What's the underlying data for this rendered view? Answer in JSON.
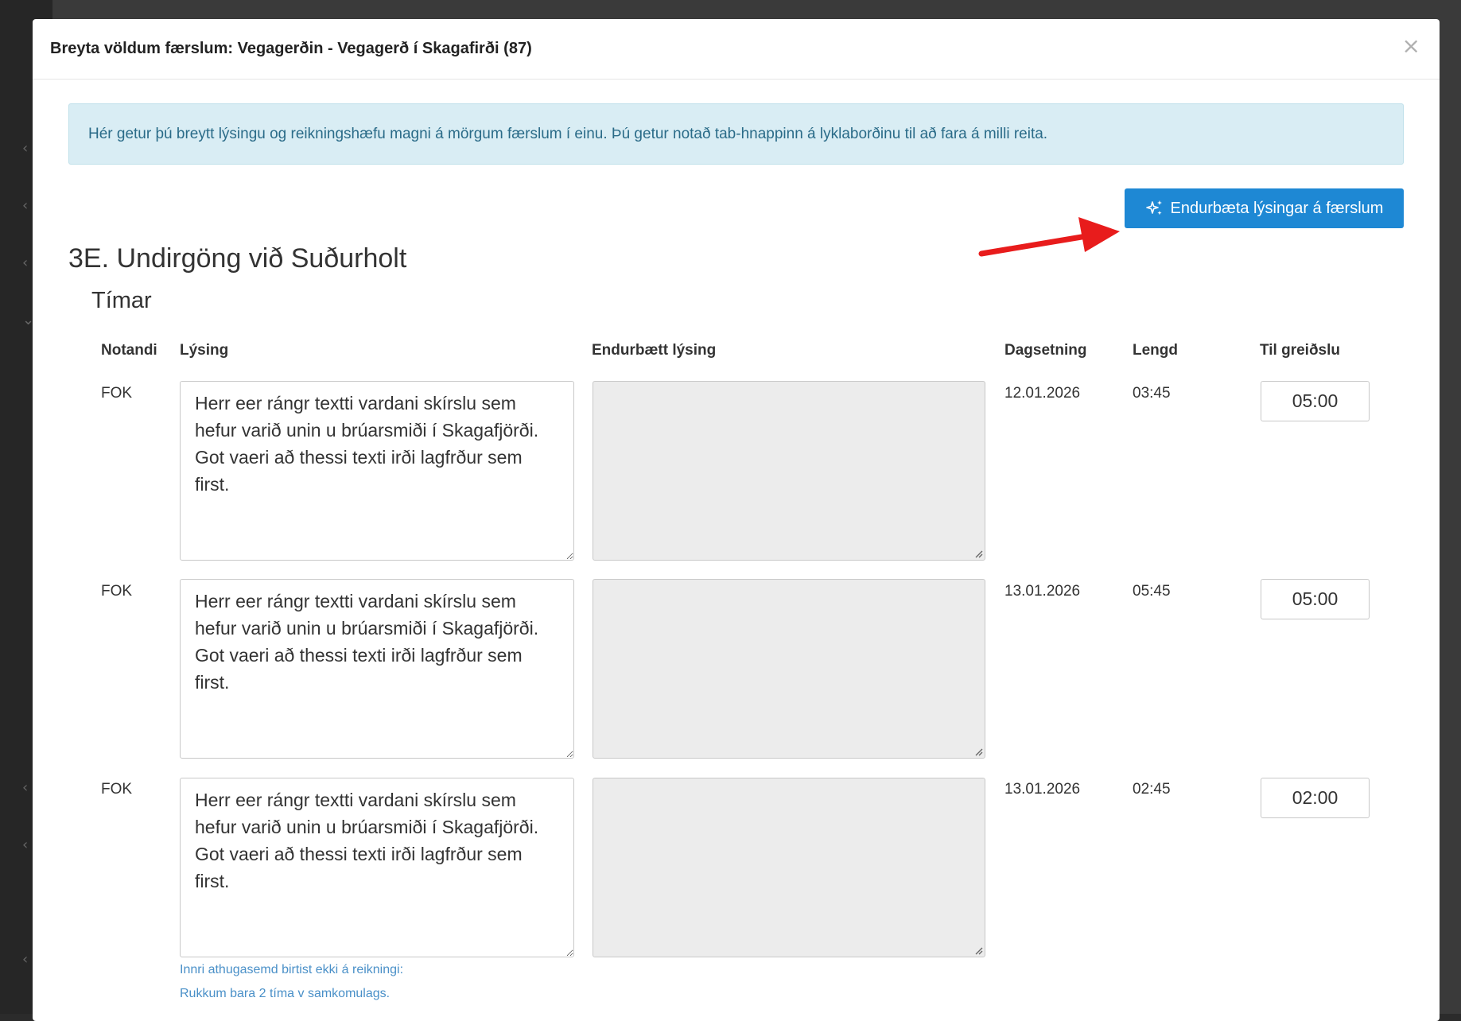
{
  "modal": {
    "title": "Breyta völdum færslum: Vegagerðin - Vegagerð í Skagafirði (87)",
    "close_label": "×"
  },
  "info": {
    "text": "Hér getur þú breytt lýsingu og reikningshæfu magni á mörgum færslum í einu. Þú getur notað tab-hnappinn á lyklaborðinu til að fara á milli reita."
  },
  "enhance_button": {
    "label": "Endurbæta lýsingar á færslum",
    "icon": "sparkle-icon"
  },
  "section": {
    "title": "3E. Undirgöng við Suðurholt",
    "subtitle": "Tímar"
  },
  "columns": {
    "user": "Notandi",
    "description": "Lýsing",
    "enhanced": "Endurbætt lýsing",
    "date": "Dagsetning",
    "length": "Lengd",
    "payable": "Til greiðslu"
  },
  "rows": [
    {
      "user": "FOK",
      "description": "Herr eer rángr textti vardani skírslu sem hefur varið unin u brúarsmiði í Skagafjörði. Got vaeri að thessi texti irði lagfrður sem first.",
      "enhanced": "",
      "date": "12.01.2026",
      "length": "03:45",
      "payable": "05:00"
    },
    {
      "user": "FOK",
      "description": "Herr eer rángr textti vardani skírslu sem hefur varið unin u brúarsmiði í Skagafjörði. Got vaeri að thessi texti irði lagfrður sem first.",
      "enhanced": "",
      "date": "13.01.2026",
      "length": "05:45",
      "payable": "05:00"
    },
    {
      "user": "FOK",
      "description": "Herr eer rángr textti vardani skírslu sem hefur varið unin u brúarsmiði í Skagafjörði. Got vaeri að thessi texti irði lagfrður sem first.",
      "enhanced": "",
      "date": "13.01.2026",
      "length": "02:45",
      "payable": "02:00",
      "note_line1": "Innri athugasemd birtist ekki á reikningi:",
      "note_line2": "Rukkum bara 2 tíma v samkomulags."
    }
  ],
  "colors": {
    "primary": "#1e88d4",
    "alert_bg": "#d9edf4",
    "alert_text": "#2a6b88",
    "annotation_arrow": "#e81c1c"
  }
}
